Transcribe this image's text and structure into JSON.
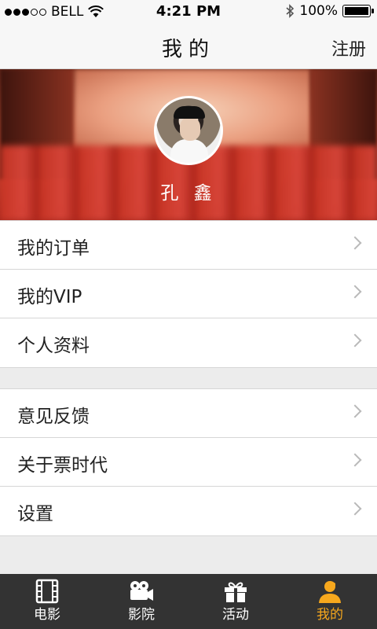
{
  "status_bar": {
    "carrier": "BELL",
    "time": "4:21 PM",
    "battery": "100%"
  },
  "nav": {
    "title": "我的",
    "register_label": "注册"
  },
  "profile": {
    "username": "孔 鑫"
  },
  "menu_group_1": [
    "我的订单",
    "我的VIP",
    "个人资料"
  ],
  "menu_group_2": [
    "意见反馈",
    "关于票时代",
    "设置"
  ],
  "tabs": [
    {
      "label": "电影",
      "icon": "film-icon"
    },
    {
      "label": "影院",
      "icon": "camera-icon"
    },
    {
      "label": "活动",
      "icon": "gift-icon"
    },
    {
      "label": "我的",
      "icon": "user-icon"
    }
  ],
  "colors": {
    "accent": "#f7a81d",
    "tab_bar": "#333333"
  }
}
